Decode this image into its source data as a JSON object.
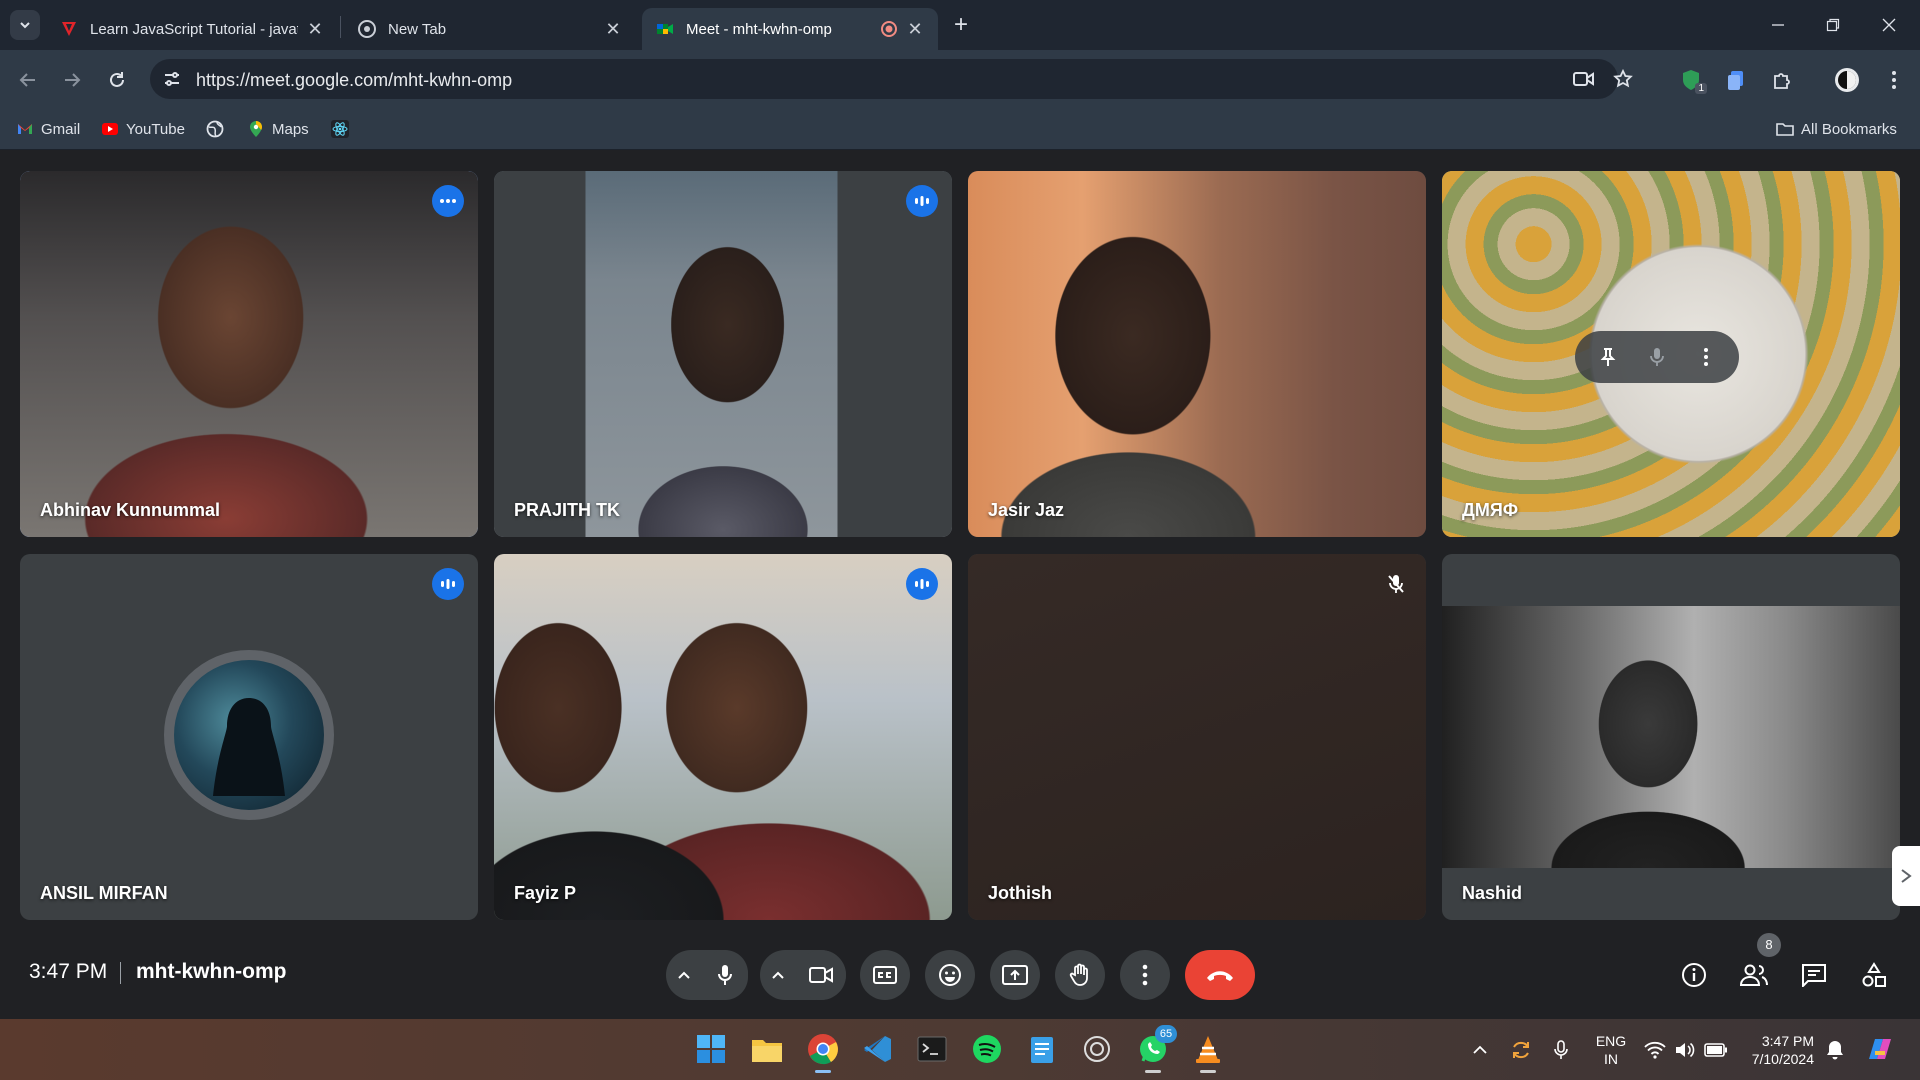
{
  "browser": {
    "tabs": [
      {
        "title": "Learn JavaScript Tutorial - javat",
        "active": false
      },
      {
        "title": "New Tab",
        "active": false
      },
      {
        "title": "Meet - mht-kwhn-omp",
        "active": true
      }
    ],
    "url": "https://meet.google.com/mht-kwhn-omp",
    "bookmarks": [
      {
        "label": "Gmail",
        "icon": "gmail-icon"
      },
      {
        "label": "YouTube",
        "icon": "youtube-icon"
      },
      {
        "label": "",
        "icon": "globe-icon"
      },
      {
        "label": "Maps",
        "icon": "maps-icon"
      },
      {
        "label": "",
        "icon": "react-icon"
      }
    ],
    "all_bookmarks_label": "All Bookmarks",
    "extension_badge": "1"
  },
  "meet": {
    "participants": [
      {
        "name": "Abhinav Kunnummal",
        "speaking": true,
        "status": "more-options"
      },
      {
        "name": "PRAJITH TK",
        "speaking": false,
        "status": "audio-active"
      },
      {
        "name": "Jasir Jaz",
        "speaking": false,
        "status": "none"
      },
      {
        "name": "ДМЯФ",
        "speaking": false,
        "status": "hover-controls"
      },
      {
        "name": "ANSIL MIRFAN",
        "speaking": false,
        "status": "audio-active"
      },
      {
        "name": "Fayiz P",
        "speaking": false,
        "status": "audio-active"
      },
      {
        "name": "Jothish",
        "speaking": false,
        "status": "muted"
      },
      {
        "name": "Nashid",
        "speaking": false,
        "status": "none"
      }
    ],
    "time": "3:47 PM",
    "meeting_code": "mht-kwhn-omp",
    "people_count": "8",
    "colors": {
      "accent": "#1a73e8",
      "speaking_outline": "#8ab4f8",
      "end_call": "#ea4335"
    }
  },
  "taskbar": {
    "whatsapp_badge": "65",
    "lang_primary": "ENG",
    "lang_secondary": "IN",
    "clock_time": "3:47 PM",
    "clock_date": "7/10/2024"
  }
}
